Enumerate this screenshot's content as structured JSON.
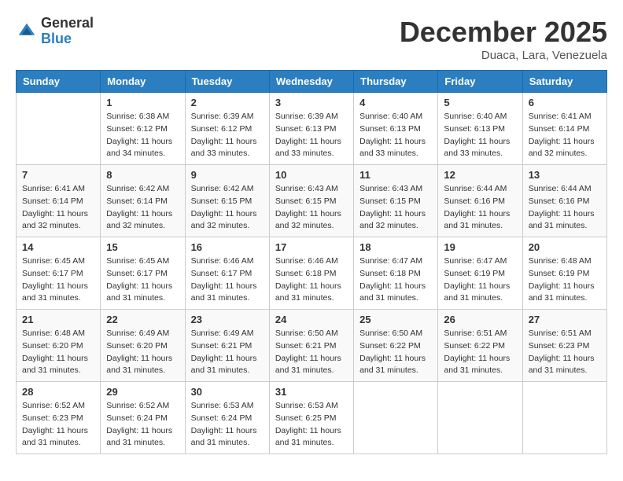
{
  "logo": {
    "general": "General",
    "blue": "Blue"
  },
  "title": "December 2025",
  "location": "Duaca, Lara, Venezuela",
  "weekdays": [
    "Sunday",
    "Monday",
    "Tuesday",
    "Wednesday",
    "Thursday",
    "Friday",
    "Saturday"
  ],
  "weeks": [
    [
      {
        "day": "",
        "info": ""
      },
      {
        "day": "1",
        "info": "Sunrise: 6:38 AM\nSunset: 6:12 PM\nDaylight: 11 hours\nand 34 minutes."
      },
      {
        "day": "2",
        "info": "Sunrise: 6:39 AM\nSunset: 6:12 PM\nDaylight: 11 hours\nand 33 minutes."
      },
      {
        "day": "3",
        "info": "Sunrise: 6:39 AM\nSunset: 6:13 PM\nDaylight: 11 hours\nand 33 minutes."
      },
      {
        "day": "4",
        "info": "Sunrise: 6:40 AM\nSunset: 6:13 PM\nDaylight: 11 hours\nand 33 minutes."
      },
      {
        "day": "5",
        "info": "Sunrise: 6:40 AM\nSunset: 6:13 PM\nDaylight: 11 hours\nand 33 minutes."
      },
      {
        "day": "6",
        "info": "Sunrise: 6:41 AM\nSunset: 6:14 PM\nDaylight: 11 hours\nand 32 minutes."
      }
    ],
    [
      {
        "day": "7",
        "info": "Sunrise: 6:41 AM\nSunset: 6:14 PM\nDaylight: 11 hours\nand 32 minutes."
      },
      {
        "day": "8",
        "info": "Sunrise: 6:42 AM\nSunset: 6:14 PM\nDaylight: 11 hours\nand 32 minutes."
      },
      {
        "day": "9",
        "info": "Sunrise: 6:42 AM\nSunset: 6:15 PM\nDaylight: 11 hours\nand 32 minutes."
      },
      {
        "day": "10",
        "info": "Sunrise: 6:43 AM\nSunset: 6:15 PM\nDaylight: 11 hours\nand 32 minutes."
      },
      {
        "day": "11",
        "info": "Sunrise: 6:43 AM\nSunset: 6:15 PM\nDaylight: 11 hours\nand 32 minutes."
      },
      {
        "day": "12",
        "info": "Sunrise: 6:44 AM\nSunset: 6:16 PM\nDaylight: 11 hours\nand 31 minutes."
      },
      {
        "day": "13",
        "info": "Sunrise: 6:44 AM\nSunset: 6:16 PM\nDaylight: 11 hours\nand 31 minutes."
      }
    ],
    [
      {
        "day": "14",
        "info": "Sunrise: 6:45 AM\nSunset: 6:17 PM\nDaylight: 11 hours\nand 31 minutes."
      },
      {
        "day": "15",
        "info": "Sunrise: 6:45 AM\nSunset: 6:17 PM\nDaylight: 11 hours\nand 31 minutes."
      },
      {
        "day": "16",
        "info": "Sunrise: 6:46 AM\nSunset: 6:17 PM\nDaylight: 11 hours\nand 31 minutes."
      },
      {
        "day": "17",
        "info": "Sunrise: 6:46 AM\nSunset: 6:18 PM\nDaylight: 11 hours\nand 31 minutes."
      },
      {
        "day": "18",
        "info": "Sunrise: 6:47 AM\nSunset: 6:18 PM\nDaylight: 11 hours\nand 31 minutes."
      },
      {
        "day": "19",
        "info": "Sunrise: 6:47 AM\nSunset: 6:19 PM\nDaylight: 11 hours\nand 31 minutes."
      },
      {
        "day": "20",
        "info": "Sunrise: 6:48 AM\nSunset: 6:19 PM\nDaylight: 11 hours\nand 31 minutes."
      }
    ],
    [
      {
        "day": "21",
        "info": "Sunrise: 6:48 AM\nSunset: 6:20 PM\nDaylight: 11 hours\nand 31 minutes."
      },
      {
        "day": "22",
        "info": "Sunrise: 6:49 AM\nSunset: 6:20 PM\nDaylight: 11 hours\nand 31 minutes."
      },
      {
        "day": "23",
        "info": "Sunrise: 6:49 AM\nSunset: 6:21 PM\nDaylight: 11 hours\nand 31 minutes."
      },
      {
        "day": "24",
        "info": "Sunrise: 6:50 AM\nSunset: 6:21 PM\nDaylight: 11 hours\nand 31 minutes."
      },
      {
        "day": "25",
        "info": "Sunrise: 6:50 AM\nSunset: 6:22 PM\nDaylight: 11 hours\nand 31 minutes."
      },
      {
        "day": "26",
        "info": "Sunrise: 6:51 AM\nSunset: 6:22 PM\nDaylight: 11 hours\nand 31 minutes."
      },
      {
        "day": "27",
        "info": "Sunrise: 6:51 AM\nSunset: 6:23 PM\nDaylight: 11 hours\nand 31 minutes."
      }
    ],
    [
      {
        "day": "28",
        "info": "Sunrise: 6:52 AM\nSunset: 6:23 PM\nDaylight: 11 hours\nand 31 minutes."
      },
      {
        "day": "29",
        "info": "Sunrise: 6:52 AM\nSunset: 6:24 PM\nDaylight: 11 hours\nand 31 minutes."
      },
      {
        "day": "30",
        "info": "Sunrise: 6:53 AM\nSunset: 6:24 PM\nDaylight: 11 hours\nand 31 minutes."
      },
      {
        "day": "31",
        "info": "Sunrise: 6:53 AM\nSunset: 6:25 PM\nDaylight: 11 hours\nand 31 minutes."
      },
      {
        "day": "",
        "info": ""
      },
      {
        "day": "",
        "info": ""
      },
      {
        "day": "",
        "info": ""
      }
    ]
  ]
}
